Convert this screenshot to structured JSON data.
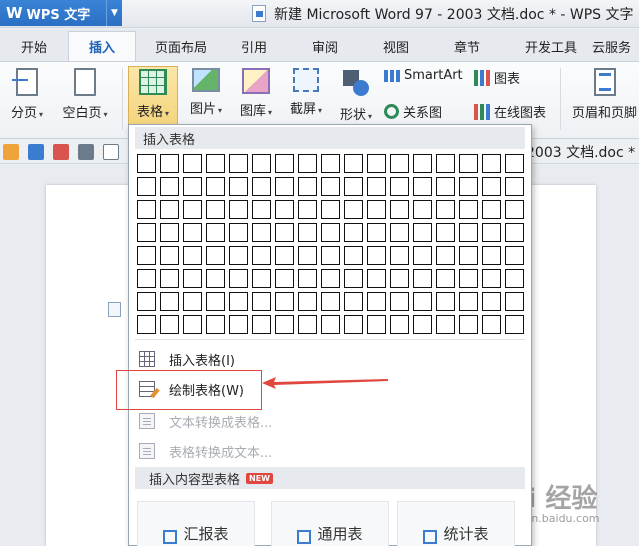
{
  "app": {
    "name": "WPS 文字",
    "window_title": "新建 Microsoft Word 97 - 2003 文档.doc * - WPS 文字"
  },
  "tabs": [
    {
      "label": "开始",
      "active": false
    },
    {
      "label": "插入",
      "active": true
    },
    {
      "label": "页面布局",
      "active": false
    },
    {
      "label": "引用",
      "active": false
    },
    {
      "label": "审阅",
      "active": false
    },
    {
      "label": "视图",
      "active": false
    },
    {
      "label": "章节",
      "active": false
    },
    {
      "label": "开发工具",
      "active": false
    },
    {
      "label": "云服务",
      "active": false
    }
  ],
  "ribbon": {
    "page_break": "分页",
    "blank_page": "空白页",
    "table": "表格",
    "picture": "图片",
    "gallery": "图库",
    "screenshot": "截屏",
    "shape": "形状",
    "smartart": "SmartArt",
    "chart": "图表",
    "relation_chart": "关系图",
    "online_chart": "在线图表",
    "header_footer": "页眉和页脚"
  },
  "doc_tab": "2003 文档.doc *",
  "dropdown": {
    "header": "插入表格",
    "grid_cols": 17,
    "grid_rows": 8,
    "items": {
      "insert_table": "插入表格(I)",
      "draw_table": "绘制表格(W)",
      "text_to_table": "文本转换成表格...",
      "table_to_text": "表格转换成文本..."
    },
    "content_header": "插入内容型表格",
    "new_badge": "NEW",
    "templates": [
      "汇报表",
      "通用表",
      "统计表"
    ]
  },
  "watermark": {
    "main": "Bai 经验",
    "sub": "jingyan.baidu.com"
  },
  "colors": {
    "accent": "#2a6fc3",
    "selected": "#f5d47a",
    "annotation_red": "#e0483f"
  }
}
